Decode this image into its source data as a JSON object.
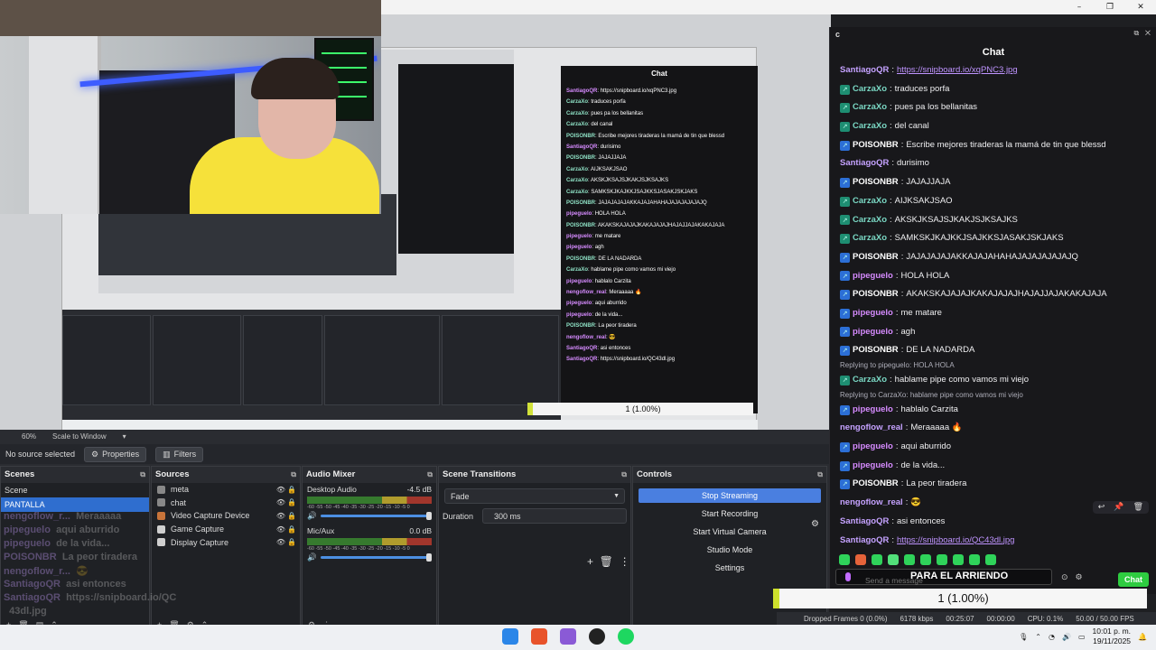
{
  "window": {
    "controls": [
      "–",
      "❐",
      "✕"
    ]
  },
  "obs": {
    "zoom": "60%",
    "scale_mode": "Scale to Window",
    "no_source": "No source selected",
    "properties_label": "Properties",
    "filters_label": "Filters",
    "scenes": {
      "title": "Scenes",
      "items": [
        "Scene",
        "PANTALLA"
      ]
    },
    "sources": {
      "title": "Sources",
      "items": [
        "meta",
        "chat",
        "Video Capture Device",
        "Game Capture",
        "Display Capture"
      ]
    },
    "mixer": {
      "title": "Audio Mixer",
      "channels": [
        {
          "name": "Desktop Audio",
          "db": "-4.5 dB"
        },
        {
          "name": "Mic/Aux",
          "db": "0.0 dB"
        }
      ],
      "scale": "-60 -55 -50 -45 -40 -35 -30 -25 -20 -15 -10 -5 0"
    },
    "transitions": {
      "title": "Scene Transitions",
      "selected": "Fade",
      "duration_label": "Duration",
      "duration_value": "300 ms"
    },
    "controls": {
      "title": "Controls",
      "stop_streaming": "Stop Streaming",
      "start_recording": "Start Recording",
      "start_virtual_camera": "Start Virtual Camera",
      "studio_mode": "Studio Mode",
      "settings": "Settings"
    },
    "status": {
      "dropped": "Dropped Frames 0 (0.0%)",
      "kbps": "6178 kbps",
      "time1": "00:25:07",
      "time2": "00:00:00",
      "cpu": "CPU: 0.1%",
      "fps": "50.00 / 50.00 FPS"
    }
  },
  "counter": "1 (1.00%)",
  "chat": {
    "window_letter": "c",
    "title": "Chat",
    "messages": [
      {
        "user": "SantiagoQR",
        "color": "#c5a2ff",
        "badge": "",
        "text": "",
        "link": "https://snipboard.io/xqPNC3.jpg"
      },
      {
        "user": "CarzaXo",
        "color": "#7ad8c4",
        "badge": "g",
        "text": "traduces porfa",
        "link": ""
      },
      {
        "user": "CarzaXo",
        "color": "#7ad8c4",
        "badge": "g",
        "text": "pues pa los bellanitas",
        "link": ""
      },
      {
        "user": "CarzaXo",
        "color": "#7ad8c4",
        "badge": "g",
        "text": "del canal",
        "link": ""
      },
      {
        "user": "POISONBR",
        "color": "#ffffff",
        "badge": "b",
        "text": "Escribe mejores tiraderas la mamá de tin que blessd",
        "link": ""
      },
      {
        "user": "SantiagoQR",
        "color": "#c5a2ff",
        "badge": "",
        "text": "durisimo",
        "link": ""
      },
      {
        "user": "POISONBR",
        "color": "#ffffff",
        "badge": "b",
        "text": "JAJAJJAJA",
        "link": ""
      },
      {
        "user": "CarzaXo",
        "color": "#7ad8c4",
        "badge": "g",
        "text": "AIJKSAKJSAO",
        "link": ""
      },
      {
        "user": "CarzaXo",
        "color": "#7ad8c4",
        "badge": "g",
        "text": "AKSKJKSAJSJKAKJSJKSAJKS",
        "link": ""
      },
      {
        "user": "CarzaXo",
        "color": "#7ad8c4",
        "badge": "g",
        "text": "SAMKSKJKAJKKJSAJKKSJASAKJSKJAKS",
        "link": ""
      },
      {
        "user": "POISONBR",
        "color": "#ffffff",
        "badge": "b",
        "text": "JAJAJAJAJAKKAJAJAHAHAJAJAJAJAJAJQ",
        "link": ""
      },
      {
        "user": "pipeguelo",
        "color": "#d68bff",
        "badge": "b",
        "text": "HOLA HOLA",
        "link": ""
      },
      {
        "user": "POISONBR",
        "color": "#ffffff",
        "badge": "b",
        "text": "AKAKSKAJAJAJKAKAJAJAJHAJAJJAJAKAKAJAJA",
        "link": ""
      },
      {
        "user": "pipeguelo",
        "color": "#d68bff",
        "badge": "b",
        "text": "me matare",
        "link": ""
      },
      {
        "user": "pipeguelo",
        "color": "#d68bff",
        "badge": "b",
        "text": "agh",
        "link": ""
      },
      {
        "user": "POISONBR",
        "color": "#ffffff",
        "badge": "b",
        "text": "DE LA NADARDA",
        "link": ""
      },
      {
        "reply": "Replying to pipeguelo: HOLA HOLA"
      },
      {
        "user": "CarzaXo",
        "color": "#7ad8c4",
        "badge": "g",
        "text": "hablame pipe como vamos mi viejo",
        "link": ""
      },
      {
        "reply": "Replying to CarzaXo: hablame pipe como vamos mi viejo"
      },
      {
        "user": "pipeguelo",
        "color": "#d68bff",
        "badge": "b",
        "text": "hablalo Carzita",
        "link": ""
      },
      {
        "user": "nengoflow_real",
        "color": "#c5a2ff",
        "badge": "",
        "text": "Meraaaaa 🔥",
        "link": ""
      },
      {
        "user": "pipeguelo",
        "color": "#d68bff",
        "badge": "b",
        "text": "aqui aburrido",
        "link": ""
      },
      {
        "user": "pipeguelo",
        "color": "#d68bff",
        "badge": "b",
        "text": "de la vida...",
        "link": ""
      },
      {
        "user": "POISONBR",
        "color": "#ffffff",
        "badge": "b",
        "text": "La peor tiradera",
        "link": ""
      },
      {
        "user": "nengoflow_real",
        "color": "#c5a2ff",
        "badge": "",
        "text": "😎",
        "link": ""
      },
      {
        "user": "SantiagoQR",
        "color": "#c5a2ff",
        "badge": "",
        "text": "asi entonces",
        "link": ""
      },
      {
        "user": "SantiagoQR",
        "color": "#c5a2ff",
        "badge": "",
        "text": "",
        "link": "https://snipboard.io/QC43dl.jpg"
      }
    ],
    "input_placeholder": "Send a message",
    "banner": "PARA EL ARRIENDO",
    "send_label": "Chat"
  },
  "overlay_lines": [
    {
      "user": "nengoflow_r...",
      "text": "Meraaaaa"
    },
    {
      "user": "pipeguelo",
      "text": "aqui aburrido"
    },
    {
      "user": "pipeguelo",
      "text": "de la vida..."
    },
    {
      "user": "POISONBR",
      "text": "La peor tiradera"
    },
    {
      "user": "nengoflow_r...",
      "text": "😎"
    },
    {
      "user": "SantiagoQR",
      "text": "asi entonces"
    },
    {
      "user": "SantiagoQR",
      "text": "https://snipboard.io/QC"
    },
    {
      "user": "",
      "text": "43dl.jpg"
    }
  ],
  "taskbar": {
    "time": "10:01 p. m.",
    "date": "19/11/2025"
  },
  "colors": {
    "accent": "#4a7fe0",
    "chat_bg": "#18181b",
    "obs_bg": "#2a2c31",
    "progress_accent": "#cde02c"
  }
}
